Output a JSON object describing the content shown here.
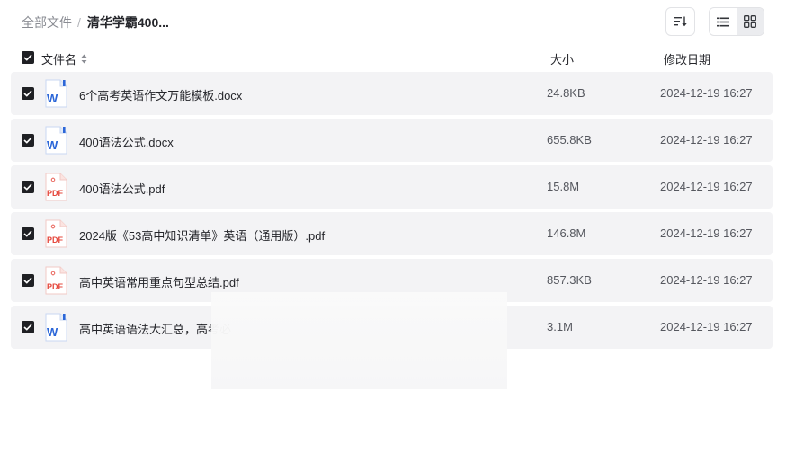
{
  "breadcrumb": {
    "root": "全部文件",
    "separator": "/",
    "current": "清华学霸400..."
  },
  "toolbar": {
    "sort_icon": "sort-icon",
    "list_view_icon": "list-view-icon",
    "grid_view_icon": "grid-view-icon",
    "active_view": "list"
  },
  "columns": {
    "name": "文件名",
    "size": "大小",
    "date": "修改日期"
  },
  "colors": {
    "word": "#2b66d8",
    "pdf": "#e5483d",
    "row_bg": "#f3f3f5",
    "checkbox": "#1f2024"
  },
  "files": [
    {
      "name": "6个高考英语作文万能模板.docx",
      "size": "24.8KB",
      "date": "2024-12-19 16:27",
      "type": "word",
      "icon": "word-doc-icon",
      "checked": true
    },
    {
      "name": "400语法公式.docx",
      "size": "655.8KB",
      "date": "2024-12-19 16:27",
      "type": "word",
      "icon": "word-doc-icon",
      "checked": true
    },
    {
      "name": "400语法公式.pdf",
      "size": "15.8M",
      "date": "2024-12-19 16:27",
      "type": "pdf",
      "icon": "pdf-icon",
      "icon_label": "PDF",
      "checked": true
    },
    {
      "name": "2024版《53高中知识清单》英语（通用版）.pdf",
      "size": "146.8M",
      "date": "2024-12-19 16:27",
      "type": "pdf",
      "icon": "pdf-icon",
      "icon_label": "PDF",
      "checked": true
    },
    {
      "name": "高中英语常用重点句型总结.pdf",
      "size": "857.3KB",
      "date": "2024-12-19 16:27",
      "type": "pdf",
      "icon": "pdf-icon",
      "icon_label": "PDF",
      "checked": true
    },
    {
      "name": "高中英语语法大汇总，高考必",
      "size": "3.1M",
      "date": "2024-12-19 16:27",
      "type": "word",
      "icon": "word-doc-icon",
      "checked": true
    }
  ]
}
